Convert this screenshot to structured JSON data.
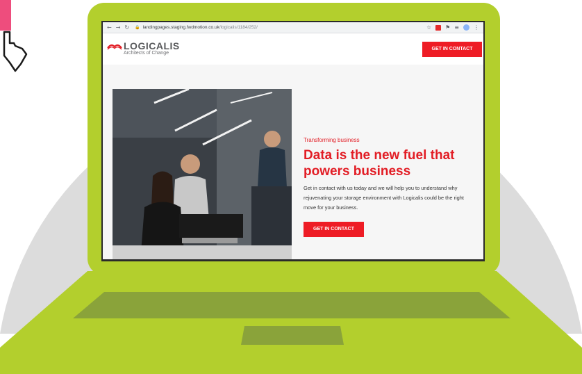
{
  "colors": {
    "laptop_green": "#b3cf2d",
    "laptop_dark_green": "#8aa33a",
    "backdrop_grey": "#dcdcdc",
    "brand_red": "#e21d25",
    "cta_red": "#ee1c25",
    "cursor_pink": "#ee4d7d"
  },
  "browser": {
    "back_icon": "arrow-left-icon",
    "forward_icon": "arrow-right-icon",
    "reload_icon": "reload-icon",
    "lock_icon": "lock-icon",
    "url_host": "landingpages.staging.fwdmotion.co.uk",
    "url_path": "/logicalis/1184/252/",
    "extension_icons": [
      "star-icon",
      "extension-icon",
      "puzzle-icon",
      "media-icon",
      "profile-avatar",
      "more-icon"
    ]
  },
  "header": {
    "logo_text": "LOGICALIS",
    "logo_tagline": "Architects of Change",
    "cta_label": "GET IN CONTACT"
  },
  "hero": {
    "eyebrow": "Transforming business",
    "headline": "Data is the new fuel that powers business",
    "body": "Get in contact with us today and we will help you to understand why rejuvenating your storage environment with Logicalis could be the right move for your business.",
    "cta_label": "GET IN CONTACT",
    "image": "office-team-photo"
  },
  "decor": {
    "cursor_icon": "hand-pointer-icon"
  }
}
